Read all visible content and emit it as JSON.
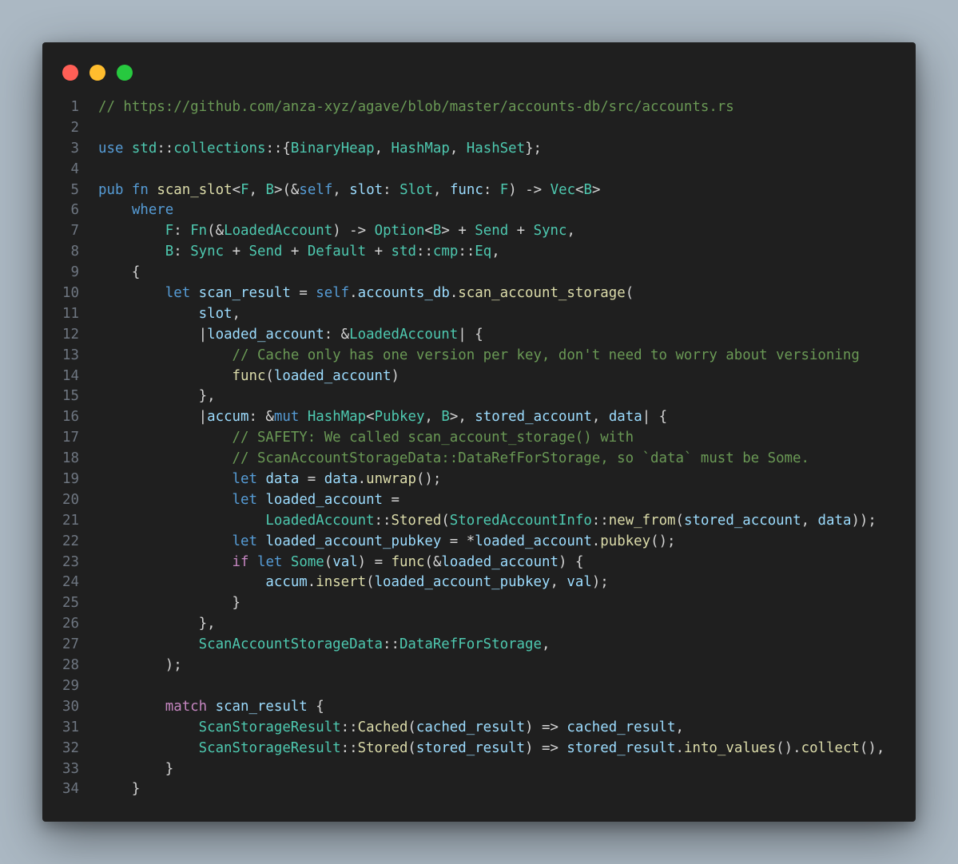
{
  "window": {
    "dots": [
      {
        "name": "close",
        "color": "#ff5f56"
      },
      {
        "name": "minimize",
        "color": "#ffbd2e"
      },
      {
        "name": "maximize",
        "color": "#27c93f"
      }
    ]
  },
  "theme": {
    "background": "#abb8c3",
    "editor_background": "#1f1f1f",
    "keyword": "#569cd6",
    "control": "#c586c0",
    "function": "#dcdcaa",
    "type": "#4ec9b0",
    "variable": "#9cdcfe",
    "comment": "#6a9955",
    "punctuation": "#d4d4d4",
    "line_number": "#6e7681"
  },
  "code": {
    "language": "rust",
    "lines": [
      {
        "n": "1",
        "tokens": [
          [
            "cm",
            "// https://github.com/anza-xyz/agave/blob/master/accounts-db/src/accounts.rs"
          ]
        ]
      },
      {
        "n": "2",
        "tokens": []
      },
      {
        "n": "3",
        "tokens": [
          [
            "kw",
            "use"
          ],
          [
            "p",
            " "
          ],
          [
            "ty",
            "std"
          ],
          [
            "p",
            "::"
          ],
          [
            "ty",
            "collections"
          ],
          [
            "p",
            "::{"
          ],
          [
            "ty",
            "BinaryHeap"
          ],
          [
            "p",
            ", "
          ],
          [
            "ty",
            "HashMap"
          ],
          [
            "p",
            ", "
          ],
          [
            "ty",
            "HashSet"
          ],
          [
            "p",
            "};"
          ]
        ]
      },
      {
        "n": "4",
        "tokens": []
      },
      {
        "n": "5",
        "tokens": [
          [
            "kw",
            "pub"
          ],
          [
            "p",
            " "
          ],
          [
            "kw",
            "fn"
          ],
          [
            "p",
            " "
          ],
          [
            "fn",
            "scan_slot"
          ],
          [
            "p",
            "<"
          ],
          [
            "ty",
            "F"
          ],
          [
            "p",
            ", "
          ],
          [
            "ty",
            "B"
          ],
          [
            "p",
            ">(&"
          ],
          [
            "kw",
            "self"
          ],
          [
            "p",
            ", "
          ],
          [
            "var",
            "slot"
          ],
          [
            "p",
            ": "
          ],
          [
            "ty",
            "Slot"
          ],
          [
            "p",
            ", "
          ],
          [
            "var",
            "func"
          ],
          [
            "p",
            ": "
          ],
          [
            "ty",
            "F"
          ],
          [
            "p",
            ") -> "
          ],
          [
            "ty",
            "Vec"
          ],
          [
            "p",
            "<"
          ],
          [
            "ty",
            "B"
          ],
          [
            "p",
            ">"
          ]
        ]
      },
      {
        "n": "6",
        "tokens": [
          [
            "p",
            "    "
          ],
          [
            "kw",
            "where"
          ]
        ]
      },
      {
        "n": "7",
        "tokens": [
          [
            "p",
            "        "
          ],
          [
            "ty",
            "F"
          ],
          [
            "p",
            ": "
          ],
          [
            "ty",
            "Fn"
          ],
          [
            "p",
            "(&"
          ],
          [
            "ty",
            "LoadedAccount"
          ],
          [
            "p",
            ") -> "
          ],
          [
            "ty",
            "Option"
          ],
          [
            "p",
            "<"
          ],
          [
            "ty",
            "B"
          ],
          [
            "p",
            "> + "
          ],
          [
            "ty",
            "Send"
          ],
          [
            "p",
            " + "
          ],
          [
            "ty",
            "Sync"
          ],
          [
            "p",
            ","
          ]
        ]
      },
      {
        "n": "8",
        "tokens": [
          [
            "p",
            "        "
          ],
          [
            "ty",
            "B"
          ],
          [
            "p",
            ": "
          ],
          [
            "ty",
            "Sync"
          ],
          [
            "p",
            " + "
          ],
          [
            "ty",
            "Send"
          ],
          [
            "p",
            " + "
          ],
          [
            "ty",
            "Default"
          ],
          [
            "p",
            " + "
          ],
          [
            "ty",
            "std"
          ],
          [
            "p",
            "::"
          ],
          [
            "ty",
            "cmp"
          ],
          [
            "p",
            "::"
          ],
          [
            "ty",
            "Eq"
          ],
          [
            "p",
            ","
          ]
        ]
      },
      {
        "n": "9",
        "tokens": [
          [
            "p",
            "    {"
          ]
        ]
      },
      {
        "n": "10",
        "tokens": [
          [
            "p",
            "        "
          ],
          [
            "kw",
            "let"
          ],
          [
            "p",
            " "
          ],
          [
            "var",
            "scan_result"
          ],
          [
            "p",
            " = "
          ],
          [
            "kw",
            "self"
          ],
          [
            "p",
            "."
          ],
          [
            "var",
            "accounts_db"
          ],
          [
            "p",
            "."
          ],
          [
            "fn",
            "scan_account_storage"
          ],
          [
            "p",
            "("
          ]
        ]
      },
      {
        "n": "11",
        "tokens": [
          [
            "p",
            "            "
          ],
          [
            "var",
            "slot"
          ],
          [
            "p",
            ","
          ]
        ]
      },
      {
        "n": "12",
        "tokens": [
          [
            "p",
            "            |"
          ],
          [
            "var",
            "loaded_account"
          ],
          [
            "p",
            ": &"
          ],
          [
            "ty",
            "LoadedAccount"
          ],
          [
            "p",
            "| {"
          ]
        ]
      },
      {
        "n": "13",
        "tokens": [
          [
            "p",
            "                "
          ],
          [
            "cm",
            "// Cache only has one version per key, don't need to worry about versioning"
          ]
        ]
      },
      {
        "n": "14",
        "tokens": [
          [
            "p",
            "                "
          ],
          [
            "fn",
            "func"
          ],
          [
            "p",
            "("
          ],
          [
            "var",
            "loaded_account"
          ],
          [
            "p",
            ")"
          ]
        ]
      },
      {
        "n": "15",
        "tokens": [
          [
            "p",
            "            },"
          ]
        ]
      },
      {
        "n": "16",
        "tokens": [
          [
            "p",
            "            |"
          ],
          [
            "var",
            "accum"
          ],
          [
            "p",
            ": &"
          ],
          [
            "kw",
            "mut"
          ],
          [
            "p",
            " "
          ],
          [
            "ty",
            "HashMap"
          ],
          [
            "p",
            "<"
          ],
          [
            "ty",
            "Pubkey"
          ],
          [
            "p",
            ", "
          ],
          [
            "ty",
            "B"
          ],
          [
            "p",
            ">, "
          ],
          [
            "var",
            "stored_account"
          ],
          [
            "p",
            ", "
          ],
          [
            "var",
            "data"
          ],
          [
            "p",
            "| {"
          ]
        ]
      },
      {
        "n": "17",
        "tokens": [
          [
            "p",
            "                "
          ],
          [
            "cm",
            "// SAFETY: We called scan_account_storage() with"
          ]
        ]
      },
      {
        "n": "18",
        "tokens": [
          [
            "p",
            "                "
          ],
          [
            "cm",
            "// ScanAccountStorageData::DataRefForStorage, so `data` must be Some."
          ]
        ]
      },
      {
        "n": "19",
        "tokens": [
          [
            "p",
            "                "
          ],
          [
            "kw",
            "let"
          ],
          [
            "p",
            " "
          ],
          [
            "var",
            "data"
          ],
          [
            "p",
            " = "
          ],
          [
            "var",
            "data"
          ],
          [
            "p",
            "."
          ],
          [
            "fn",
            "unwrap"
          ],
          [
            "p",
            "();"
          ]
        ]
      },
      {
        "n": "20",
        "tokens": [
          [
            "p",
            "                "
          ],
          [
            "kw",
            "let"
          ],
          [
            "p",
            " "
          ],
          [
            "var",
            "loaded_account"
          ],
          [
            "p",
            " ="
          ]
        ]
      },
      {
        "n": "21",
        "tokens": [
          [
            "p",
            "                    "
          ],
          [
            "ty",
            "LoadedAccount"
          ],
          [
            "p",
            "::"
          ],
          [
            "fn",
            "Stored"
          ],
          [
            "p",
            "("
          ],
          [
            "ty",
            "StoredAccountInfo"
          ],
          [
            "p",
            "::"
          ],
          [
            "fn",
            "new_from"
          ],
          [
            "p",
            "("
          ],
          [
            "var",
            "stored_account"
          ],
          [
            "p",
            ", "
          ],
          [
            "var",
            "data"
          ],
          [
            "p",
            "));"
          ]
        ]
      },
      {
        "n": "22",
        "tokens": [
          [
            "p",
            "                "
          ],
          [
            "kw",
            "let"
          ],
          [
            "p",
            " "
          ],
          [
            "var",
            "loaded_account_pubkey"
          ],
          [
            "p",
            " = *"
          ],
          [
            "var",
            "loaded_account"
          ],
          [
            "p",
            "."
          ],
          [
            "fn",
            "pubkey"
          ],
          [
            "p",
            "();"
          ]
        ]
      },
      {
        "n": "23",
        "tokens": [
          [
            "p",
            "                "
          ],
          [
            "ctl",
            "if"
          ],
          [
            "p",
            " "
          ],
          [
            "kw",
            "let"
          ],
          [
            "p",
            " "
          ],
          [
            "ty",
            "Some"
          ],
          [
            "p",
            "("
          ],
          [
            "var",
            "val"
          ],
          [
            "p",
            ") = "
          ],
          [
            "fn",
            "func"
          ],
          [
            "p",
            "(&"
          ],
          [
            "var",
            "loaded_account"
          ],
          [
            "p",
            ") {"
          ]
        ]
      },
      {
        "n": "24",
        "tokens": [
          [
            "p",
            "                    "
          ],
          [
            "var",
            "accum"
          ],
          [
            "p",
            "."
          ],
          [
            "fn",
            "insert"
          ],
          [
            "p",
            "("
          ],
          [
            "var",
            "loaded_account_pubkey"
          ],
          [
            "p",
            ", "
          ],
          [
            "var",
            "val"
          ],
          [
            "p",
            ");"
          ]
        ]
      },
      {
        "n": "25",
        "tokens": [
          [
            "p",
            "                }"
          ]
        ]
      },
      {
        "n": "26",
        "tokens": [
          [
            "p",
            "            },"
          ]
        ]
      },
      {
        "n": "27",
        "tokens": [
          [
            "p",
            "            "
          ],
          [
            "ty",
            "ScanAccountStorageData"
          ],
          [
            "p",
            "::"
          ],
          [
            "ty",
            "DataRefForStorage"
          ],
          [
            "p",
            ","
          ]
        ]
      },
      {
        "n": "28",
        "tokens": [
          [
            "p",
            "        );"
          ]
        ]
      },
      {
        "n": "29",
        "tokens": []
      },
      {
        "n": "30",
        "tokens": [
          [
            "p",
            "        "
          ],
          [
            "ctl",
            "match"
          ],
          [
            "p",
            " "
          ],
          [
            "var",
            "scan_result"
          ],
          [
            "p",
            " {"
          ]
        ]
      },
      {
        "n": "31",
        "tokens": [
          [
            "p",
            "            "
          ],
          [
            "ty",
            "ScanStorageResult"
          ],
          [
            "p",
            "::"
          ],
          [
            "fn",
            "Cached"
          ],
          [
            "p",
            "("
          ],
          [
            "var",
            "cached_result"
          ],
          [
            "p",
            ") => "
          ],
          [
            "var",
            "cached_result"
          ],
          [
            "p",
            ","
          ]
        ]
      },
      {
        "n": "32",
        "tokens": [
          [
            "p",
            "            "
          ],
          [
            "ty",
            "ScanStorageResult"
          ],
          [
            "p",
            "::"
          ],
          [
            "fn",
            "Stored"
          ],
          [
            "p",
            "("
          ],
          [
            "var",
            "stored_result"
          ],
          [
            "p",
            ") => "
          ],
          [
            "var",
            "stored_result"
          ],
          [
            "p",
            "."
          ],
          [
            "fn",
            "into_values"
          ],
          [
            "p",
            "()."
          ],
          [
            "fn",
            "collect"
          ],
          [
            "p",
            "(),"
          ]
        ]
      },
      {
        "n": "33",
        "tokens": [
          [
            "p",
            "        }"
          ]
        ]
      },
      {
        "n": "34",
        "tokens": [
          [
            "p",
            "    }"
          ]
        ]
      }
    ]
  }
}
